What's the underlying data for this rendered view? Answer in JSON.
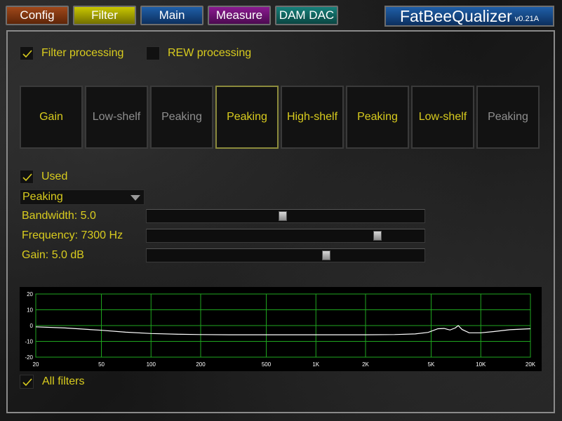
{
  "tabs": [
    {
      "label": "Config"
    },
    {
      "label": "Filter"
    },
    {
      "label": "Main"
    },
    {
      "label": "Measure"
    },
    {
      "label": "DAM DAC"
    }
  ],
  "app": {
    "title": "FatBeeQualizer",
    "version": "v0.21A"
  },
  "options": {
    "filter_processing": {
      "label": "Filter processing",
      "checked": true
    },
    "rew_processing": {
      "label": "REW processing",
      "checked": false
    }
  },
  "bands": [
    {
      "label": "Gain",
      "active": true,
      "selected": false
    },
    {
      "label": "Low-shelf",
      "active": false,
      "selected": false
    },
    {
      "label": "Peaking",
      "active": false,
      "selected": false
    },
    {
      "label": "Peaking",
      "active": true,
      "selected": true
    },
    {
      "label": "High-shelf",
      "active": true,
      "selected": false
    },
    {
      "label": "Peaking",
      "active": true,
      "selected": false
    },
    {
      "label": "Low-shelf",
      "active": true,
      "selected": false
    },
    {
      "label": "Peaking",
      "active": false,
      "selected": false
    }
  ],
  "filter": {
    "used": {
      "label": "Used",
      "checked": true
    },
    "type": "Peaking",
    "bandwidth": {
      "label": "Bandwidth:  5.0",
      "position": 0.49
    },
    "frequency": {
      "label": "Frequency: 7300 Hz",
      "position": 0.84
    },
    "gain": {
      "label": "Gain:  5.0 dB",
      "position": 0.65
    }
  },
  "all_filters": {
    "label": "All filters",
    "checked": true
  },
  "chart_data": {
    "type": "line",
    "x_scale": "log",
    "x_ticks": [
      20,
      50,
      100,
      200,
      500,
      1000,
      2000,
      5000,
      10000,
      20000
    ],
    "x_tick_labels": [
      "20",
      "50",
      "100",
      "200",
      "500",
      "1K",
      "2K",
      "5K",
      "10K",
      "20K"
    ],
    "y_ticks": [
      20,
      10,
      0,
      -10,
      -20
    ],
    "y_tick_labels": [
      "20",
      "10",
      "0",
      "-10",
      "-20"
    ],
    "xlim": [
      20,
      20000
    ],
    "ylim": [
      -20,
      20
    ],
    "grid": true,
    "colors": {
      "grid": "#1fa61f",
      "curve": "#ffffff",
      "background": "#000000"
    },
    "series": [
      {
        "x": [
          20,
          30,
          50,
          70,
          100,
          150,
          200,
          300,
          500,
          1000,
          2000,
          3000,
          4000,
          4800,
          5500,
          6000,
          6500,
          7000,
          7300,
          7700,
          8500,
          10000,
          12000,
          15000,
          20000
        ],
        "y": [
          -0.8,
          -1.5,
          -3.0,
          -4.2,
          -5.0,
          -5.5,
          -5.7,
          -5.8,
          -5.8,
          -5.8,
          -5.8,
          -5.7,
          -5.3,
          -4.3,
          -2.0,
          -1.8,
          -2.8,
          -1.5,
          0.0,
          -2.5,
          -4.6,
          -4.6,
          -3.8,
          -2.6,
          -2.0
        ]
      }
    ]
  }
}
